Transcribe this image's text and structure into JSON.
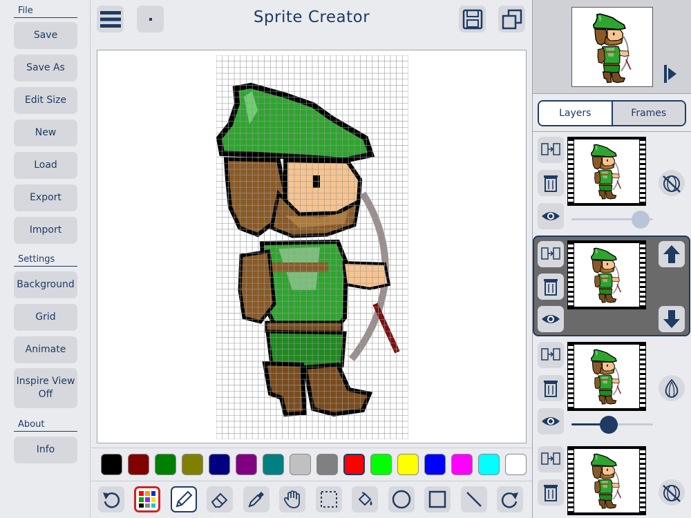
{
  "app": {
    "title": "Sprite Creator"
  },
  "sidebar": {
    "file_title": "File",
    "file_items": [
      "Save",
      "Save As",
      "Edit Size",
      "New",
      "Load",
      "Export",
      "Import"
    ],
    "settings_title": "Settings",
    "settings_items": [
      "Background",
      "Grid",
      "Animate"
    ],
    "inspire_line1": "Inspire View",
    "inspire_line2": "Off",
    "about_title": "About",
    "info_label": "Info"
  },
  "topbar": {
    "menu_icon": "hamburger-icon",
    "dot_icon": "dot-icon",
    "save_icon": "floppy-icon",
    "copy_icon": "copy-icon"
  },
  "palette": {
    "colors": [
      "#000000",
      "#800000",
      "#008000",
      "#808000",
      "#000080",
      "#800080",
      "#008080",
      "#c0c0c0",
      "#808080",
      "#ff0000",
      "#00ff00",
      "#ffff00",
      "#0000ff",
      "#ff00ff",
      "#00ffff",
      "#ffffff"
    ],
    "selected_index": 9
  },
  "tools": [
    "undo-icon",
    "palette-icon",
    "pencil-icon",
    "eraser-icon",
    "eyedropper-icon",
    "hand-icon",
    "select-rect-icon",
    "fill-bucket-icon",
    "circle-icon",
    "rectangle-icon",
    "line-icon",
    "redo-icon"
  ],
  "right_panel": {
    "tabs": [
      "Layers",
      "Frames"
    ],
    "active_tab": "Frames",
    "frame_opacity": [
      0.95,
      0.45
    ]
  },
  "colors": {
    "accent": "#1f3a63",
    "hat": "#2ea52e",
    "skin": "#f7c48f",
    "hair": "#8a5a26",
    "tunic": "#2ea52e",
    "boots": "#7a4c1c"
  }
}
